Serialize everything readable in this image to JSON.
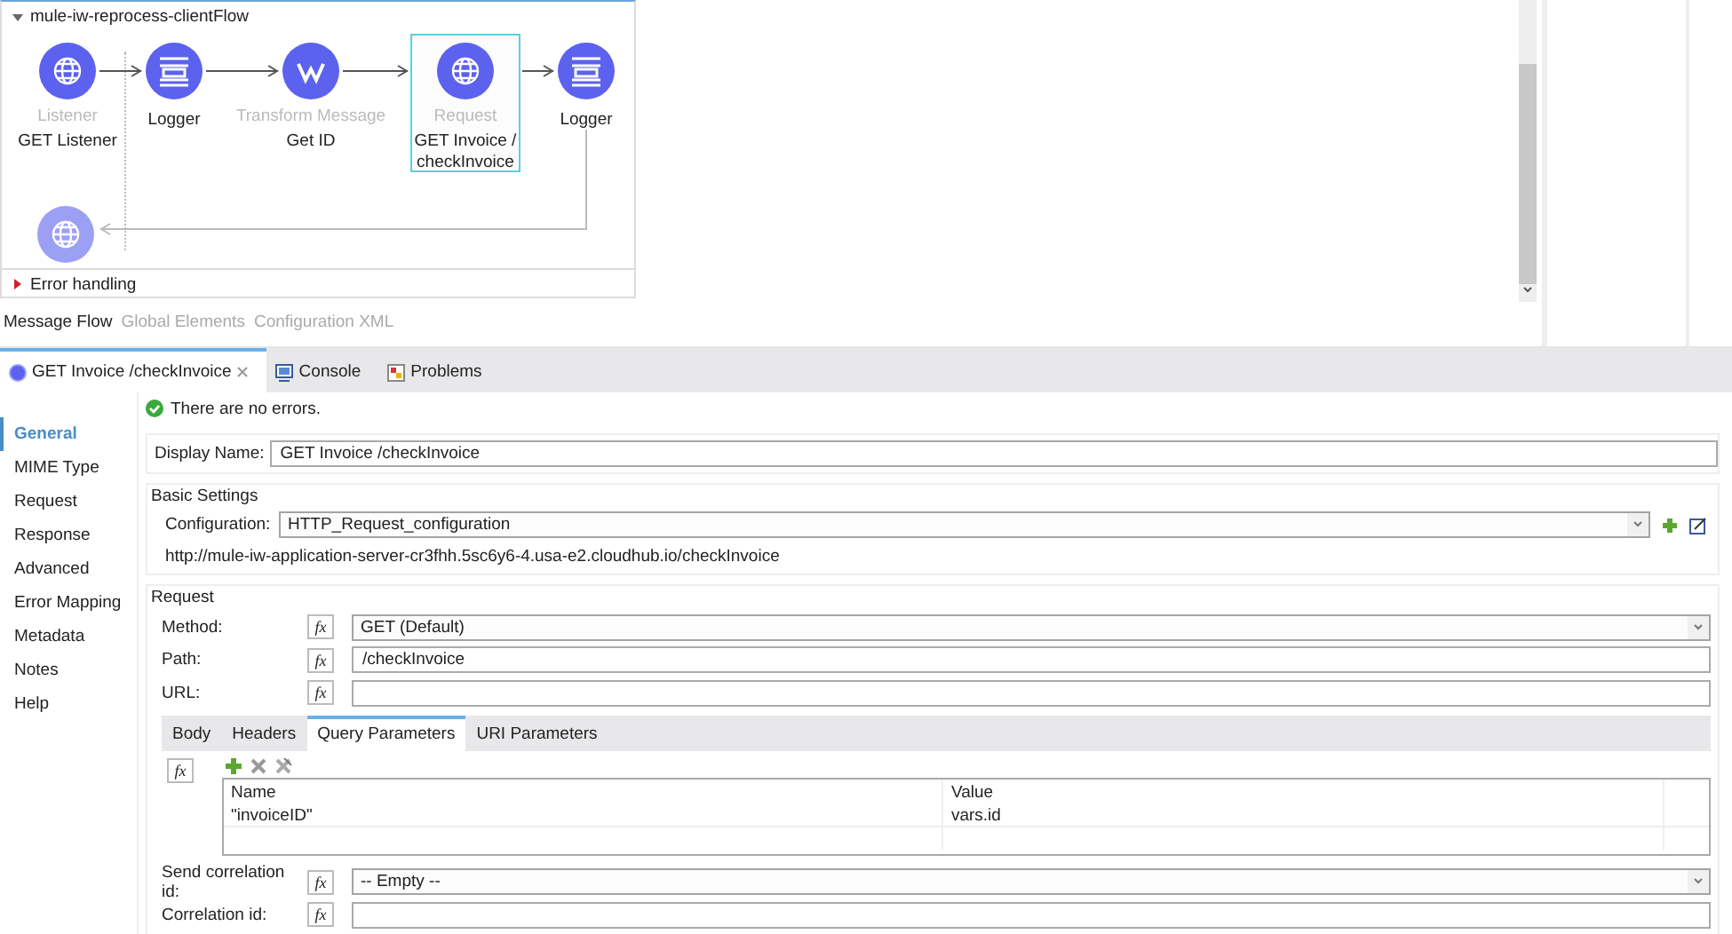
{
  "flow": {
    "title": "mule-iw-reprocess-clientFlow",
    "expanded": true,
    "nodes": [
      {
        "kind": "listener",
        "type": "Listener",
        "name": "GET Listener",
        "selected": false
      },
      {
        "kind": "logger",
        "name": "Logger",
        "selected": false
      },
      {
        "kind": "transform",
        "type": "Transform Message",
        "name": "Get ID",
        "selected": false
      },
      {
        "kind": "request",
        "type": "Request",
        "name": "GET Invoice / checkInvoice",
        "selected": true
      },
      {
        "kind": "logger",
        "name": "Logger",
        "selected": false
      }
    ],
    "error_handling": {
      "label": "Error handling",
      "expanded": false
    }
  },
  "canvas_tabs": [
    {
      "label": "Message Flow",
      "selected": true
    },
    {
      "label": "Global Elements",
      "selected": false
    },
    {
      "label": "Configuration XML",
      "selected": false
    }
  ],
  "editor_tabs": [
    {
      "kind": "component",
      "label": "GET Invoice /checkInvoice",
      "selected": true,
      "closable": true
    },
    {
      "kind": "console",
      "label": "Console",
      "selected": false,
      "closable": false
    },
    {
      "kind": "problems",
      "label": "Problems",
      "selected": false,
      "closable": false
    }
  ],
  "nav": [
    {
      "label": "General",
      "selected": true
    },
    {
      "label": "MIME Type",
      "selected": false
    },
    {
      "label": "Request",
      "selected": false
    },
    {
      "label": "Response",
      "selected": false
    },
    {
      "label": "Advanced",
      "selected": false
    },
    {
      "label": "Error Mapping",
      "selected": false
    },
    {
      "label": "Metadata",
      "selected": false
    },
    {
      "label": "Notes",
      "selected": false
    },
    {
      "label": "Help",
      "selected": false
    }
  ],
  "status": "There are no errors.",
  "display_name": {
    "label": "Display Name:",
    "value": "GET Invoice /checkInvoice"
  },
  "basic_settings": {
    "title": "Basic Settings",
    "configuration": {
      "label": "Configuration:",
      "value": "HTTP_Request_configuration"
    },
    "url": "http://mule-iw-application-server-cr3fhh.5sc6y6-4.usa-e2.cloudhub.io/checkInvoice"
  },
  "request": {
    "title": "Request",
    "fields": [
      {
        "kind": "select",
        "label": "Method:",
        "fx": "fx",
        "value": "GET (Default)"
      },
      {
        "kind": "text",
        "label": "Path:",
        "fx": "fx",
        "value": "/checkInvoice"
      },
      {
        "kind": "text",
        "label": "URL:",
        "fx": "fx"
      }
    ],
    "table_fx": "fx",
    "subtabs": [
      {
        "label": "Body",
        "selected": false
      },
      {
        "label": "Headers",
        "selected": false
      },
      {
        "label": "Query Parameters",
        "selected": true
      },
      {
        "label": "URI Parameters",
        "selected": false
      }
    ],
    "table": {
      "columns": [
        "Name",
        "Value"
      ],
      "rows": [
        [
          "\"invoiceID\"",
          "vars.id"
        ]
      ]
    },
    "bottom_fields": [
      {
        "kind": "select",
        "label": "Send correlation id:",
        "fx": "fx",
        "value": "-- Empty --"
      },
      {
        "kind": "text",
        "label": "Correlation id:",
        "fx": "fx"
      }
    ]
  }
}
